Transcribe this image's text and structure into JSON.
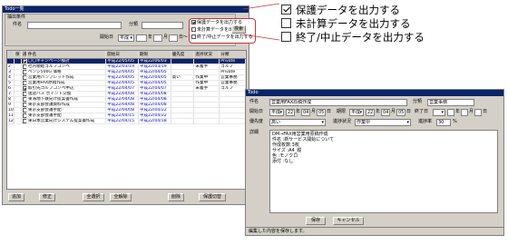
{
  "list_window": {
    "title": "Todo一覧",
    "filter_title": "抽出条件",
    "name_label": "件名",
    "category_label": "分類",
    "start_date_label": "開始日",
    "start_era": "平成",
    "year_suffix": "年",
    "month_suffix": "月",
    "day_suffix": "日",
    "tilde": "〜",
    "check_items": [
      {
        "label": "保護データを出力する",
        "checked": true
      },
      {
        "label": "未計算データを出力する",
        "checked": false
      },
      {
        "label": "終了/中止データを出力する",
        "checked": false
      }
    ],
    "search_button": "検索",
    "columns": [
      "",
      "保",
      "選",
      "件名",
      "開始日",
      "期限",
      "優先度",
      "進捗状況",
      "分類"
    ],
    "rows": [
      {
        "no": "",
        "check": true,
        "name": "〇〇キャンペーン検討",
        "start": "平成22/05/05",
        "due": "平成22/06/03",
        "prio": "",
        "status": "",
        "category": "Private",
        "selected": true
      },
      {
        "no": "2",
        "check": false,
        "name": "社内親睦ゴルフコンペ",
        "start": "平成22/03/19",
        "due": "平成22/03/19",
        "prio": "",
        "status": "未着手",
        "category": "ゴルフ",
        "selected": false
      },
      {
        "no": "3",
        "check": false,
        "name": "ペンシ500G 価格",
        "start": "平成22/04/05",
        "due": "平成22/04/05",
        "prio": "",
        "status": "",
        "category": "Private",
        "selected": false
      },
      {
        "no": "4",
        "check": false,
        "name": "営業用パンフレット作成",
        "start": "平成22/04/05",
        "due": "平成22/04/05",
        "prio": "高い",
        "status": "作業中",
        "category": "営業事務",
        "selected": false
      },
      {
        "no": "5",
        "check": false,
        "name": "営業用FAX原稿作成",
        "start": "平成22/04/05",
        "due": "平成22/04/05",
        "prio": "",
        "status": "作業中",
        "category": "営業事務",
        "selected": false
      },
      {
        "no": "6",
        "check": true,
        "name": "取引先ゴルフコンペ申込",
        "start": "平成22/04/07",
        "due": "平成22/04/07",
        "prio": "",
        "status": "未着手",
        "category": "ゴルフ",
        "selected": false
      },
      {
        "no": "7",
        "check": false,
        "name": "送迎バス ポイント交換",
        "start": "平成22/04/08",
        "due": "平成22/04/08",
        "prio": "",
        "status": "",
        "category": "",
        "selected": false
      },
      {
        "no": "8",
        "check": false,
        "name": "東海地下鉄向け提案書作成",
        "start": "平成22/04/08",
        "due": "平成22/04/08",
        "prio": "",
        "status": "",
        "category": "",
        "selected": false
      },
      {
        "no": "9",
        "check": false,
        "name": "東京支部会議資料作成",
        "start": "平成22/04/08",
        "due": "平成22/04/08",
        "prio": "",
        "status": "",
        "category": "",
        "selected": false
      },
      {
        "no": "10",
        "check": false,
        "name": "東京支部会議手配",
        "start": "平成22/04/08",
        "due": "平成22/04/22",
        "prio": "",
        "status": "",
        "category": "",
        "selected": false
      },
      {
        "no": "11",
        "check": false,
        "name": "東京支部会議手配",
        "start": "平成22/04/15",
        "due": "平成22/04/22",
        "prio": "",
        "status": "",
        "category": "",
        "selected": false
      },
      {
        "no": "12",
        "check": false,
        "name": "東日本営業向けシステム提案書作成",
        "start": "平成22/04/15",
        "due": "平成22/04/18",
        "prio": "",
        "status": "",
        "category": "",
        "selected": false
      }
    ],
    "buttons": {
      "add": "追加",
      "edit": "修正",
      "select_all": "全選択",
      "deselect_all": "全解除",
      "delete": "削除",
      "protect": "保護切替"
    }
  },
  "detail_window": {
    "title": "Todo",
    "name_label": "件名",
    "name_value": "営業用FAX原稿作成",
    "category_label": "分類",
    "category_value": "営業事務",
    "start_label": "開始日",
    "start_era": "平成",
    "start_year": "22",
    "start_month": "04",
    "start_day": "05",
    "due_label": "期限",
    "due_era": "平成",
    "due_year": "22",
    "due_month": "04",
    "due_day": "05",
    "end_label": "終了日",
    "year_suffix": "年",
    "month_suffix": "月",
    "day_suffix": "日",
    "priority_label": "優先度",
    "priority_value": "高い",
    "status_label": "進捗状況",
    "status_value": "作業中",
    "progress_label": "進捗率",
    "progress_value": "30",
    "progress_unit": "%",
    "detail_label": "詳細",
    "detail_lines": [
      "DM→FAX用営業用原稿作成",
      "件名  :新サービス開始について",
      "作成枚数:3枚",
      "サイズ  :A4_縦",
      "色    :モノクロ",
      "添付  :なし"
    ],
    "save_button": "保存",
    "cancel_button": "キャンセル",
    "status_bar": "編集した内容を保存します。"
  },
  "callout": {
    "items": [
      {
        "label": "保護データを出力する",
        "checked": true
      },
      {
        "label": "未計算データを出力する",
        "checked": false
      },
      {
        "label": "終了/中止データを出力する",
        "checked": false
      }
    ]
  },
  "colors": {
    "accent": "#cc3333",
    "titlebar": "#0a246a",
    "selection": "#0a246a"
  }
}
